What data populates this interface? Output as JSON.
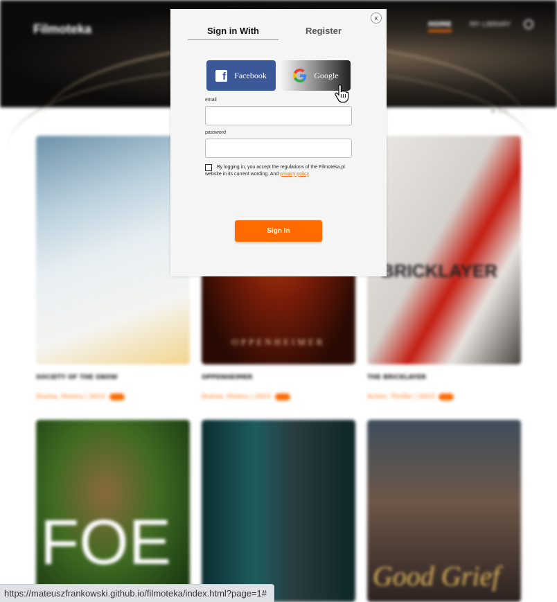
{
  "background": {
    "logo": "Filmoteka",
    "nav": {
      "home": "HOME",
      "library": "MY LIBRARY"
    },
    "theme_row": "☀ — ☾",
    "cards": [
      {
        "title": "SOCIETY OF THE SNOW",
        "meta": "Drama, History | 2023",
        "poster_text": ""
      },
      {
        "title": "OPPENHEIMER",
        "meta": "Drama, History | 2023",
        "poster_text": "OPPENHEIMER"
      },
      {
        "title": "THE BRICKLAYER",
        "meta": "Action, Thriller | 2023",
        "poster_text": "BRICKLAYER"
      },
      {
        "title": "",
        "meta": "",
        "poster_text": "FOE"
      },
      {
        "title": "",
        "meta": "",
        "poster_text": ""
      },
      {
        "title": "",
        "meta": "",
        "poster_text": "Good Grief"
      }
    ]
  },
  "modal": {
    "close_label": "x",
    "tabs": {
      "signin": "Sign in With",
      "register": "Register"
    },
    "social": {
      "facebook": "Facebook",
      "google": "Google"
    },
    "email_label": "email",
    "email_value": "",
    "password_label": "password",
    "password_value": "",
    "consent_text": "By logging in, you accept the regulations of the Filmoteka.pl website in its current wording. And ",
    "consent_link": "privacy policy",
    "signin_button": "Sign In"
  },
  "status_bar": {
    "url": "https://mateuszfrankowski.github.io/filmoteka/index.html?page=1#"
  },
  "colors": {
    "accent": "#ff6b01",
    "facebook": "#3b5998"
  }
}
